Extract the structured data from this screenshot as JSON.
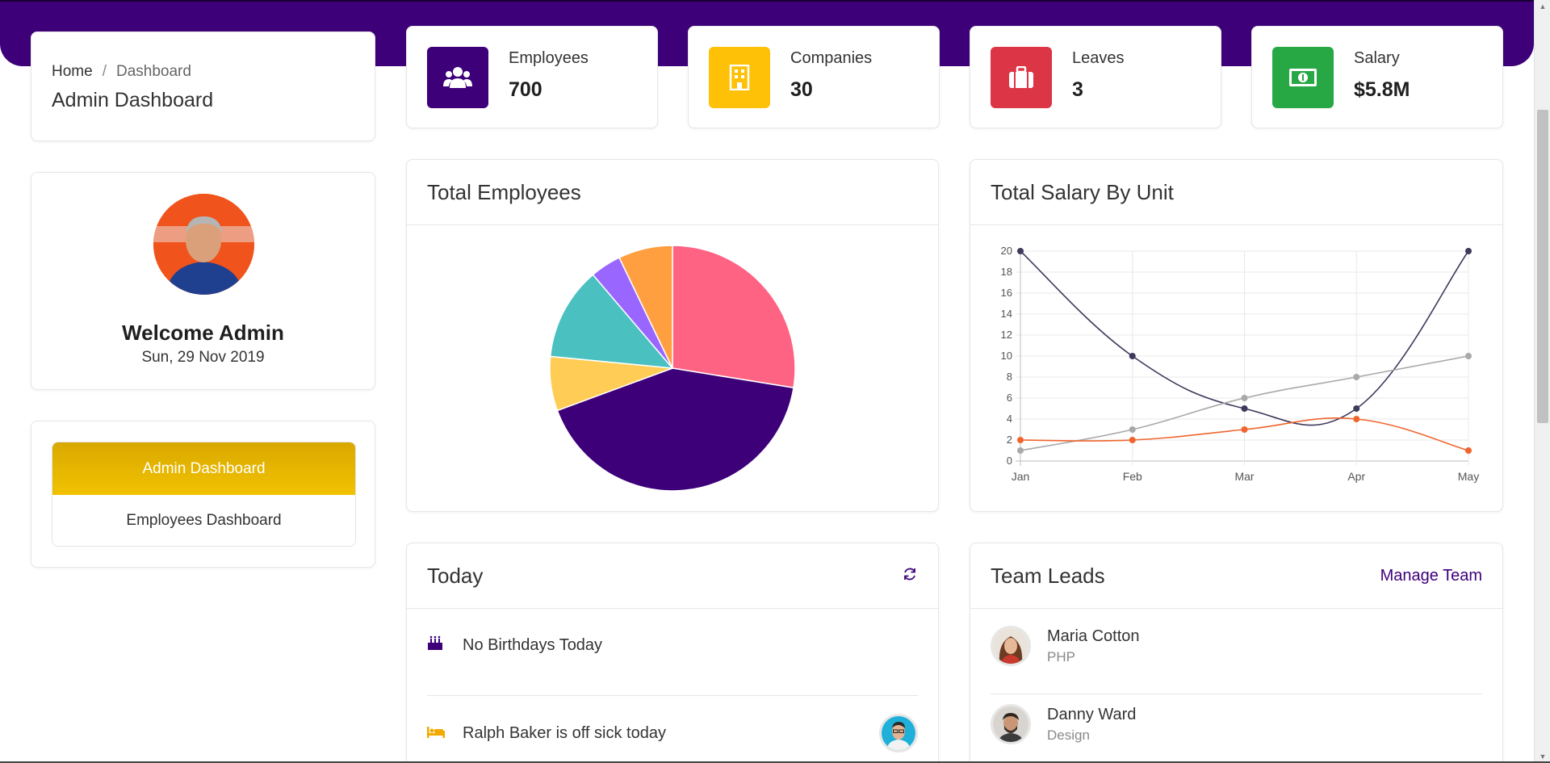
{
  "breadcrumb": {
    "home": "Home",
    "separator": "/",
    "current": "Dashboard"
  },
  "page_title": "Admin Dashboard",
  "stats": [
    {
      "label": "Employees",
      "value": "700",
      "color": "#3d0079",
      "icon": "users-icon"
    },
    {
      "label": "Companies",
      "value": "30",
      "color": "#ffc107",
      "icon": "building-icon"
    },
    {
      "label": "Leaves",
      "value": "3",
      "color": "#dc3545",
      "icon": "briefcase-icon"
    },
    {
      "label": "Salary",
      "value": "$5.8M",
      "color": "#28a745",
      "icon": "money-icon"
    }
  ],
  "profile": {
    "welcome": "Welcome Admin",
    "date": "Sun, 29 Nov 2019"
  },
  "dashboard_switch": {
    "active": "Admin Dashboard",
    "other": "Employees Dashboard",
    "active_color": "#e6b400"
  },
  "pie_panel": {
    "title": "Total Employees"
  },
  "line_panel": {
    "title": "Total Salary By Unit"
  },
  "today": {
    "title": "Today",
    "items": [
      {
        "text": "No Birthdays Today",
        "icon": "cake-icon"
      },
      {
        "text": "Ralph Baker is off sick today",
        "icon": "bed-icon"
      }
    ]
  },
  "team": {
    "title": "Team Leads",
    "manage_label": "Manage Team",
    "leads": [
      {
        "name": "Maria Cotton",
        "role": "PHP"
      },
      {
        "name": "Danny Ward",
        "role": "Design"
      }
    ]
  },
  "chart_data": [
    {
      "type": "pie",
      "title": "",
      "values": [
        27,
        41,
        7,
        12,
        4,
        7
      ],
      "colors": [
        "#ff6384",
        "#3d0079",
        "#ffcd56",
        "#4bc0c0",
        "#9966ff",
        "#ff9f40"
      ]
    },
    {
      "type": "line",
      "title": "",
      "categories": [
        "Jan",
        "Feb",
        "Mar",
        "Apr",
        "May"
      ],
      "series": [
        {
          "values": [
            20,
            10,
            5,
            5,
            20
          ],
          "color": "#3e3a5c"
        },
        {
          "values": [
            1,
            3,
            6,
            8,
            10
          ],
          "color": "#a9a9a9"
        },
        {
          "values": [
            2,
            2,
            3,
            4,
            1
          ],
          "color": "#f0652e"
        }
      ],
      "ylim": [
        0,
        20
      ],
      "yticks": [
        0,
        2,
        4,
        6,
        8,
        10,
        12,
        14,
        16,
        18,
        20
      ],
      "grid": true
    }
  ]
}
